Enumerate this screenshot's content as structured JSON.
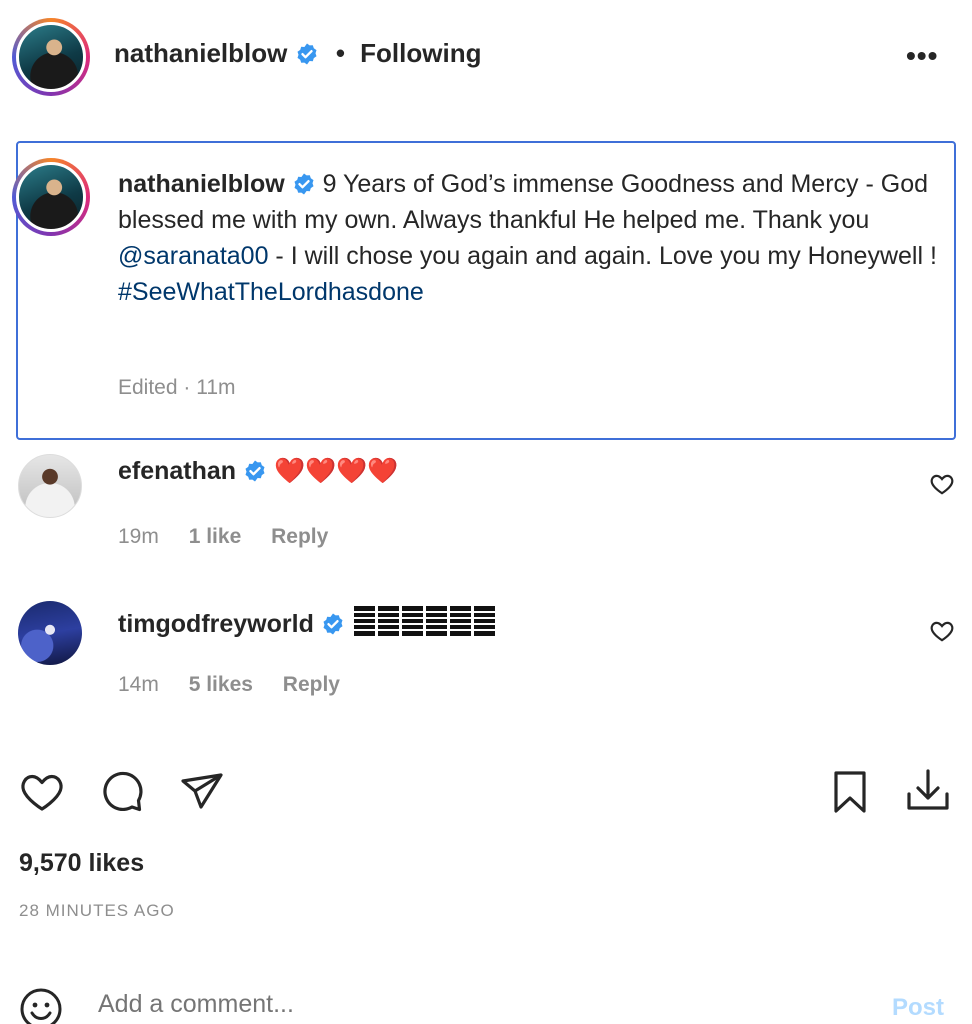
{
  "header": {
    "username": "nathanielblow",
    "separator": "•",
    "follow_status": "Following",
    "more_icon": "more-horizontal-icon"
  },
  "caption": {
    "username": "nathanielblow",
    "text_part1": "9 Years of God’s immense Goodness and Mercy - God blessed me with my own. Always thankful He helped me. Thank you ",
    "mention": "@saranata00",
    "text_part2": " - I will chose you again and again. Love you my Honeywell !",
    "hashtag": "#SeeWhatTheLordhasdone",
    "meta": "Edited · 11m"
  },
  "comments": [
    {
      "username": "efenathan",
      "text": "❤️❤️❤️❤️",
      "time": "19m",
      "likes": "1 like",
      "reply": "Reply"
    },
    {
      "username": "timgodfreyworld",
      "text": "",
      "time": "14m",
      "likes": "5 likes",
      "reply": "Reply"
    }
  ],
  "actions": {
    "icons": [
      "heart-icon",
      "comment-icon",
      "share-icon",
      "bookmark-icon",
      "download-icon"
    ]
  },
  "likes_count": "9,570 likes",
  "time_ago": "28 MINUTES AGO",
  "composer": {
    "placeholder": "Add a comment...",
    "post_label": "Post"
  },
  "colors": {
    "verified": "#3897f0",
    "link": "#00376b",
    "muted": "#8e8e8e",
    "highlight_border": "#3f6fd8",
    "heart_red": "#ed4956"
  }
}
